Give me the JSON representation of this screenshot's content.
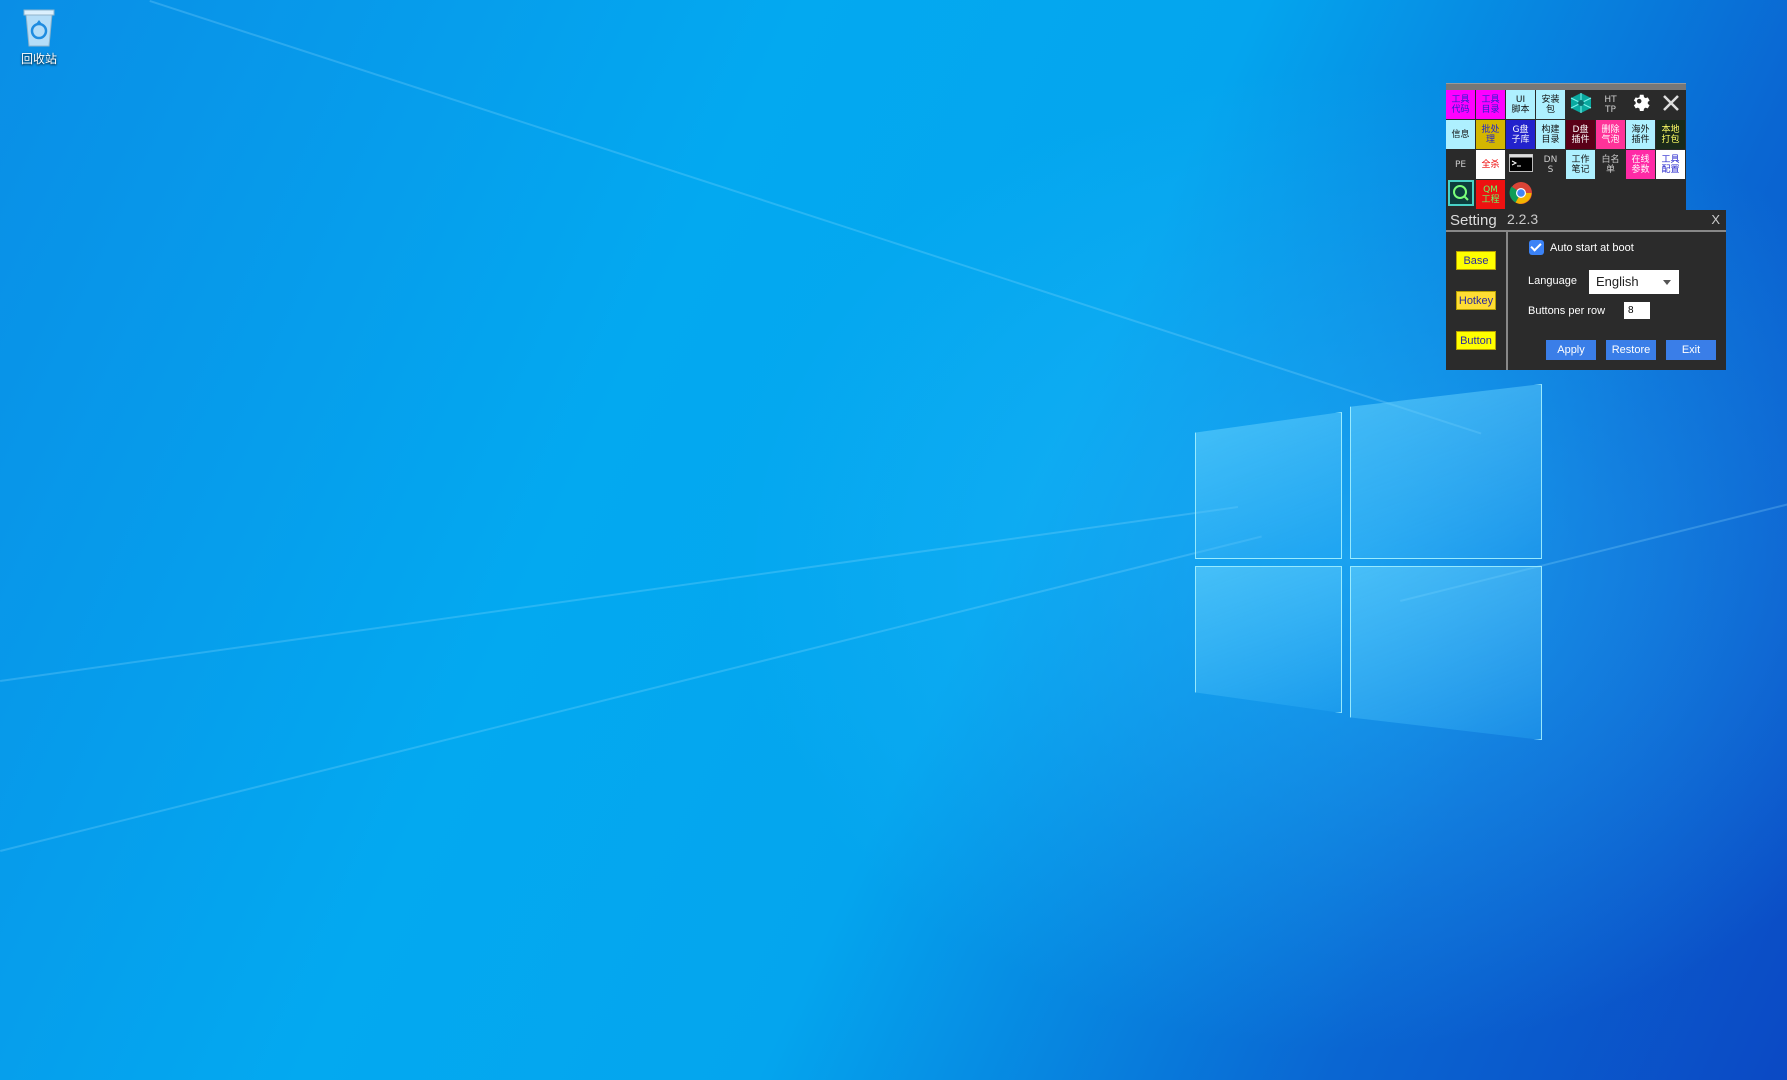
{
  "desktop": {
    "recycle_bin_label": "回收站"
  },
  "toolbar": {
    "buttons": [
      {
        "label": "工具\n代码",
        "bg": "#ff00ff",
        "fg": "#2222cc"
      },
      {
        "label": "工具\n目录",
        "bg": "#ff00ff",
        "fg": "#2222cc"
      },
      {
        "label": "UI\n脚本",
        "bg": "#aef0ff",
        "fg": "#111111"
      },
      {
        "label": "安装\n包",
        "bg": "#aef0ff",
        "fg": "#111111"
      },
      {
        "label": "",
        "bg": "#2a2a2a",
        "fg": "#ffffff",
        "icon": "cube-cluster-icon"
      },
      {
        "label": "HT\nTP",
        "bg": "#2a2a2a",
        "fg": "#cccccc"
      },
      {
        "label": "",
        "bg": "#2a2a2a",
        "fg": "#ffffff",
        "icon": "gear-icon"
      },
      {
        "label": "",
        "bg": "#2a2a2a",
        "fg": "#ffffff",
        "icon": "close-icon"
      },
      {
        "label": "信息",
        "bg": "#aef0ff",
        "fg": "#111111"
      },
      {
        "label": "批处\n理",
        "bg": "#d4b600",
        "fg": "#2222cc"
      },
      {
        "label": "G盘\n子库",
        "bg": "#2222cc",
        "fg": "#ffffff"
      },
      {
        "label": "构建\n目录",
        "bg": "#aef0ff",
        "fg": "#111111"
      },
      {
        "label": "D盘\n插件",
        "bg": "#5a0018",
        "fg": "#ffffff"
      },
      {
        "label": "删除\n气泡",
        "bg": "#ff3399",
        "fg": "#ffffff"
      },
      {
        "label": "海外\n插件",
        "bg": "#aef0ff",
        "fg": "#111111"
      },
      {
        "label": "本地\n打包",
        "bg": "#1a2a1a",
        "fg": "#ffff66"
      },
      {
        "label": "PE",
        "bg": "#2a2a2a",
        "fg": "#cccccc"
      },
      {
        "label": "全杀",
        "bg": "#ffffff",
        "fg": "#ee0000"
      },
      {
        "label": "",
        "bg": "#2a2a2a",
        "fg": "#ffffff",
        "icon": "terminal-icon"
      },
      {
        "label": "DN\nS",
        "bg": "#2a2a2a",
        "fg": "#cccccc"
      },
      {
        "label": "工作\n笔记",
        "bg": "#aef0ff",
        "fg": "#111111"
      },
      {
        "label": "白名\n单",
        "bg": "#2a2a2a",
        "fg": "#cccccc"
      },
      {
        "label": "在线\n参数",
        "bg": "#ff2aa6",
        "fg": "#ffffff"
      },
      {
        "label": "工具\n配置",
        "bg": "#ffffff",
        "fg": "#2222cc"
      },
      {
        "label": "",
        "bg": "#2a2a2a",
        "fg": "#ffffff",
        "icon": "search-app-icon"
      },
      {
        "label": "QM\n工程",
        "bg": "#ee1111",
        "fg": "#66ff66"
      },
      {
        "label": "",
        "bg": "#2a2a2a",
        "fg": "#ffffff",
        "icon": "chrome-icon"
      }
    ]
  },
  "setting": {
    "title": "Setting",
    "version": "2.2.3",
    "close_label": "X",
    "tabs": [
      "Base",
      "Hotkey",
      "Button"
    ],
    "auto_start_label": "Auto start at boot",
    "auto_start_checked": true,
    "language_label": "Language",
    "language_value": "English",
    "buttons_per_row_label": "Buttons per row",
    "buttons_per_row_value": "8",
    "apply_label": "Apply",
    "restore_label": "Restore",
    "exit_label": "Exit"
  }
}
